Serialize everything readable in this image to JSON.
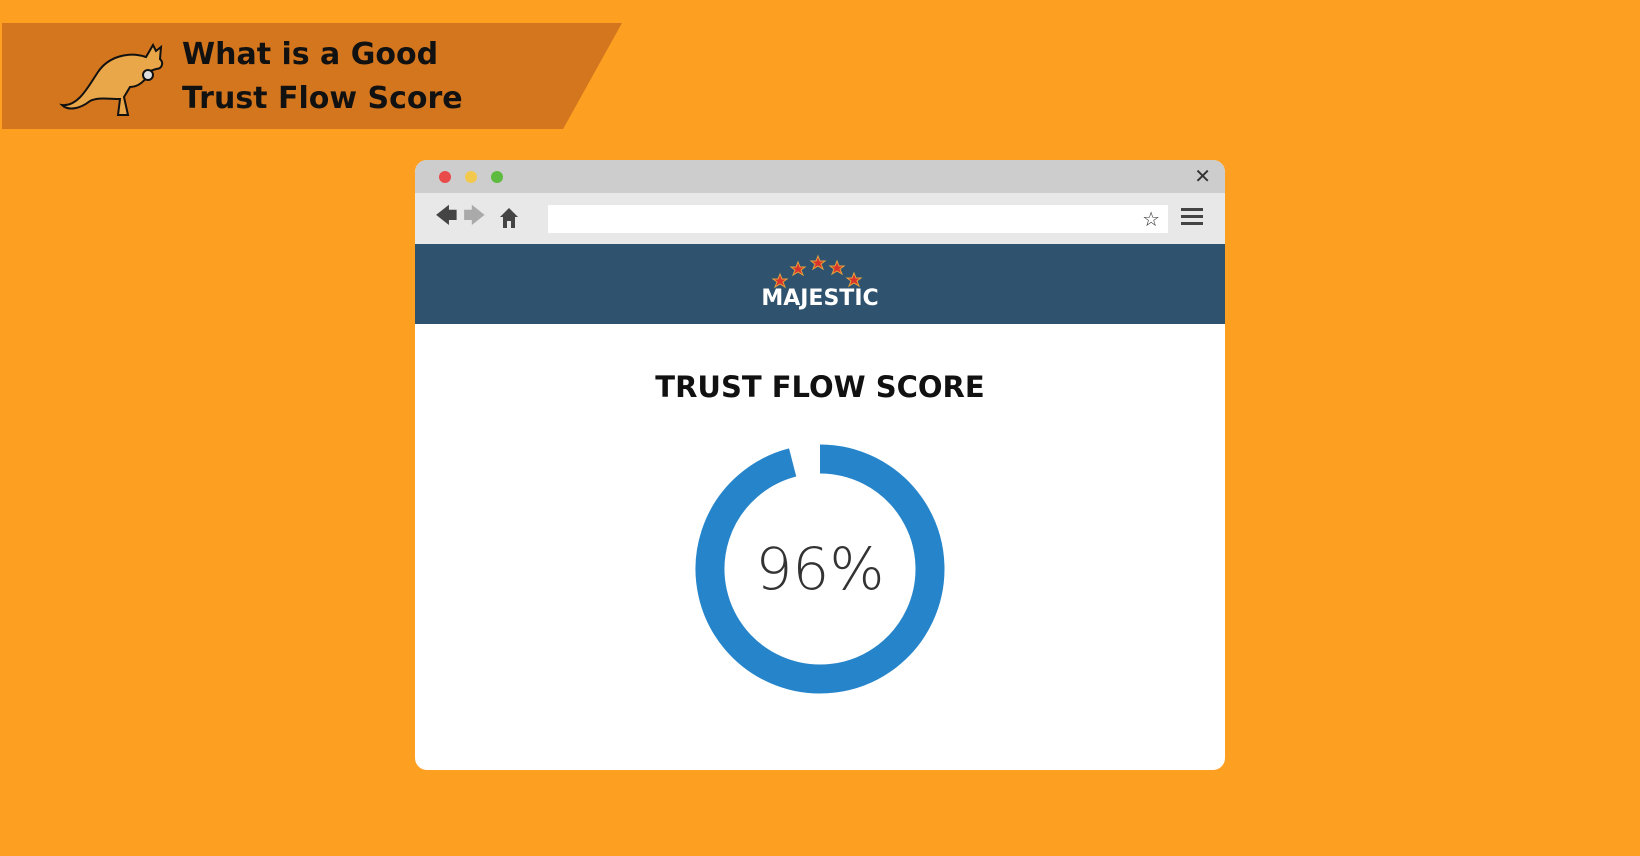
{
  "banner": {
    "title_line1": "What is a Good",
    "title_line2": "Trust Flow Score",
    "logo": "kangaroo-logo"
  },
  "browser": {
    "window_dots": [
      "#E94B4B",
      "#F2C94C",
      "#5DBB3F"
    ],
    "close_icon": "close-icon",
    "back_icon": "arrow-left-icon",
    "forward_icon": "arrow-right-icon",
    "home_icon": "home-icon",
    "address_value": "",
    "bookmark_icon": "star-outline-icon",
    "menu_icon": "hamburger-icon"
  },
  "site": {
    "brand": "MAJESTIC",
    "header_color": "#2F536E"
  },
  "score": {
    "title": "TRUST FLOW SCORE",
    "label": "96%",
    "value": 96,
    "color": "#2685CA"
  }
}
